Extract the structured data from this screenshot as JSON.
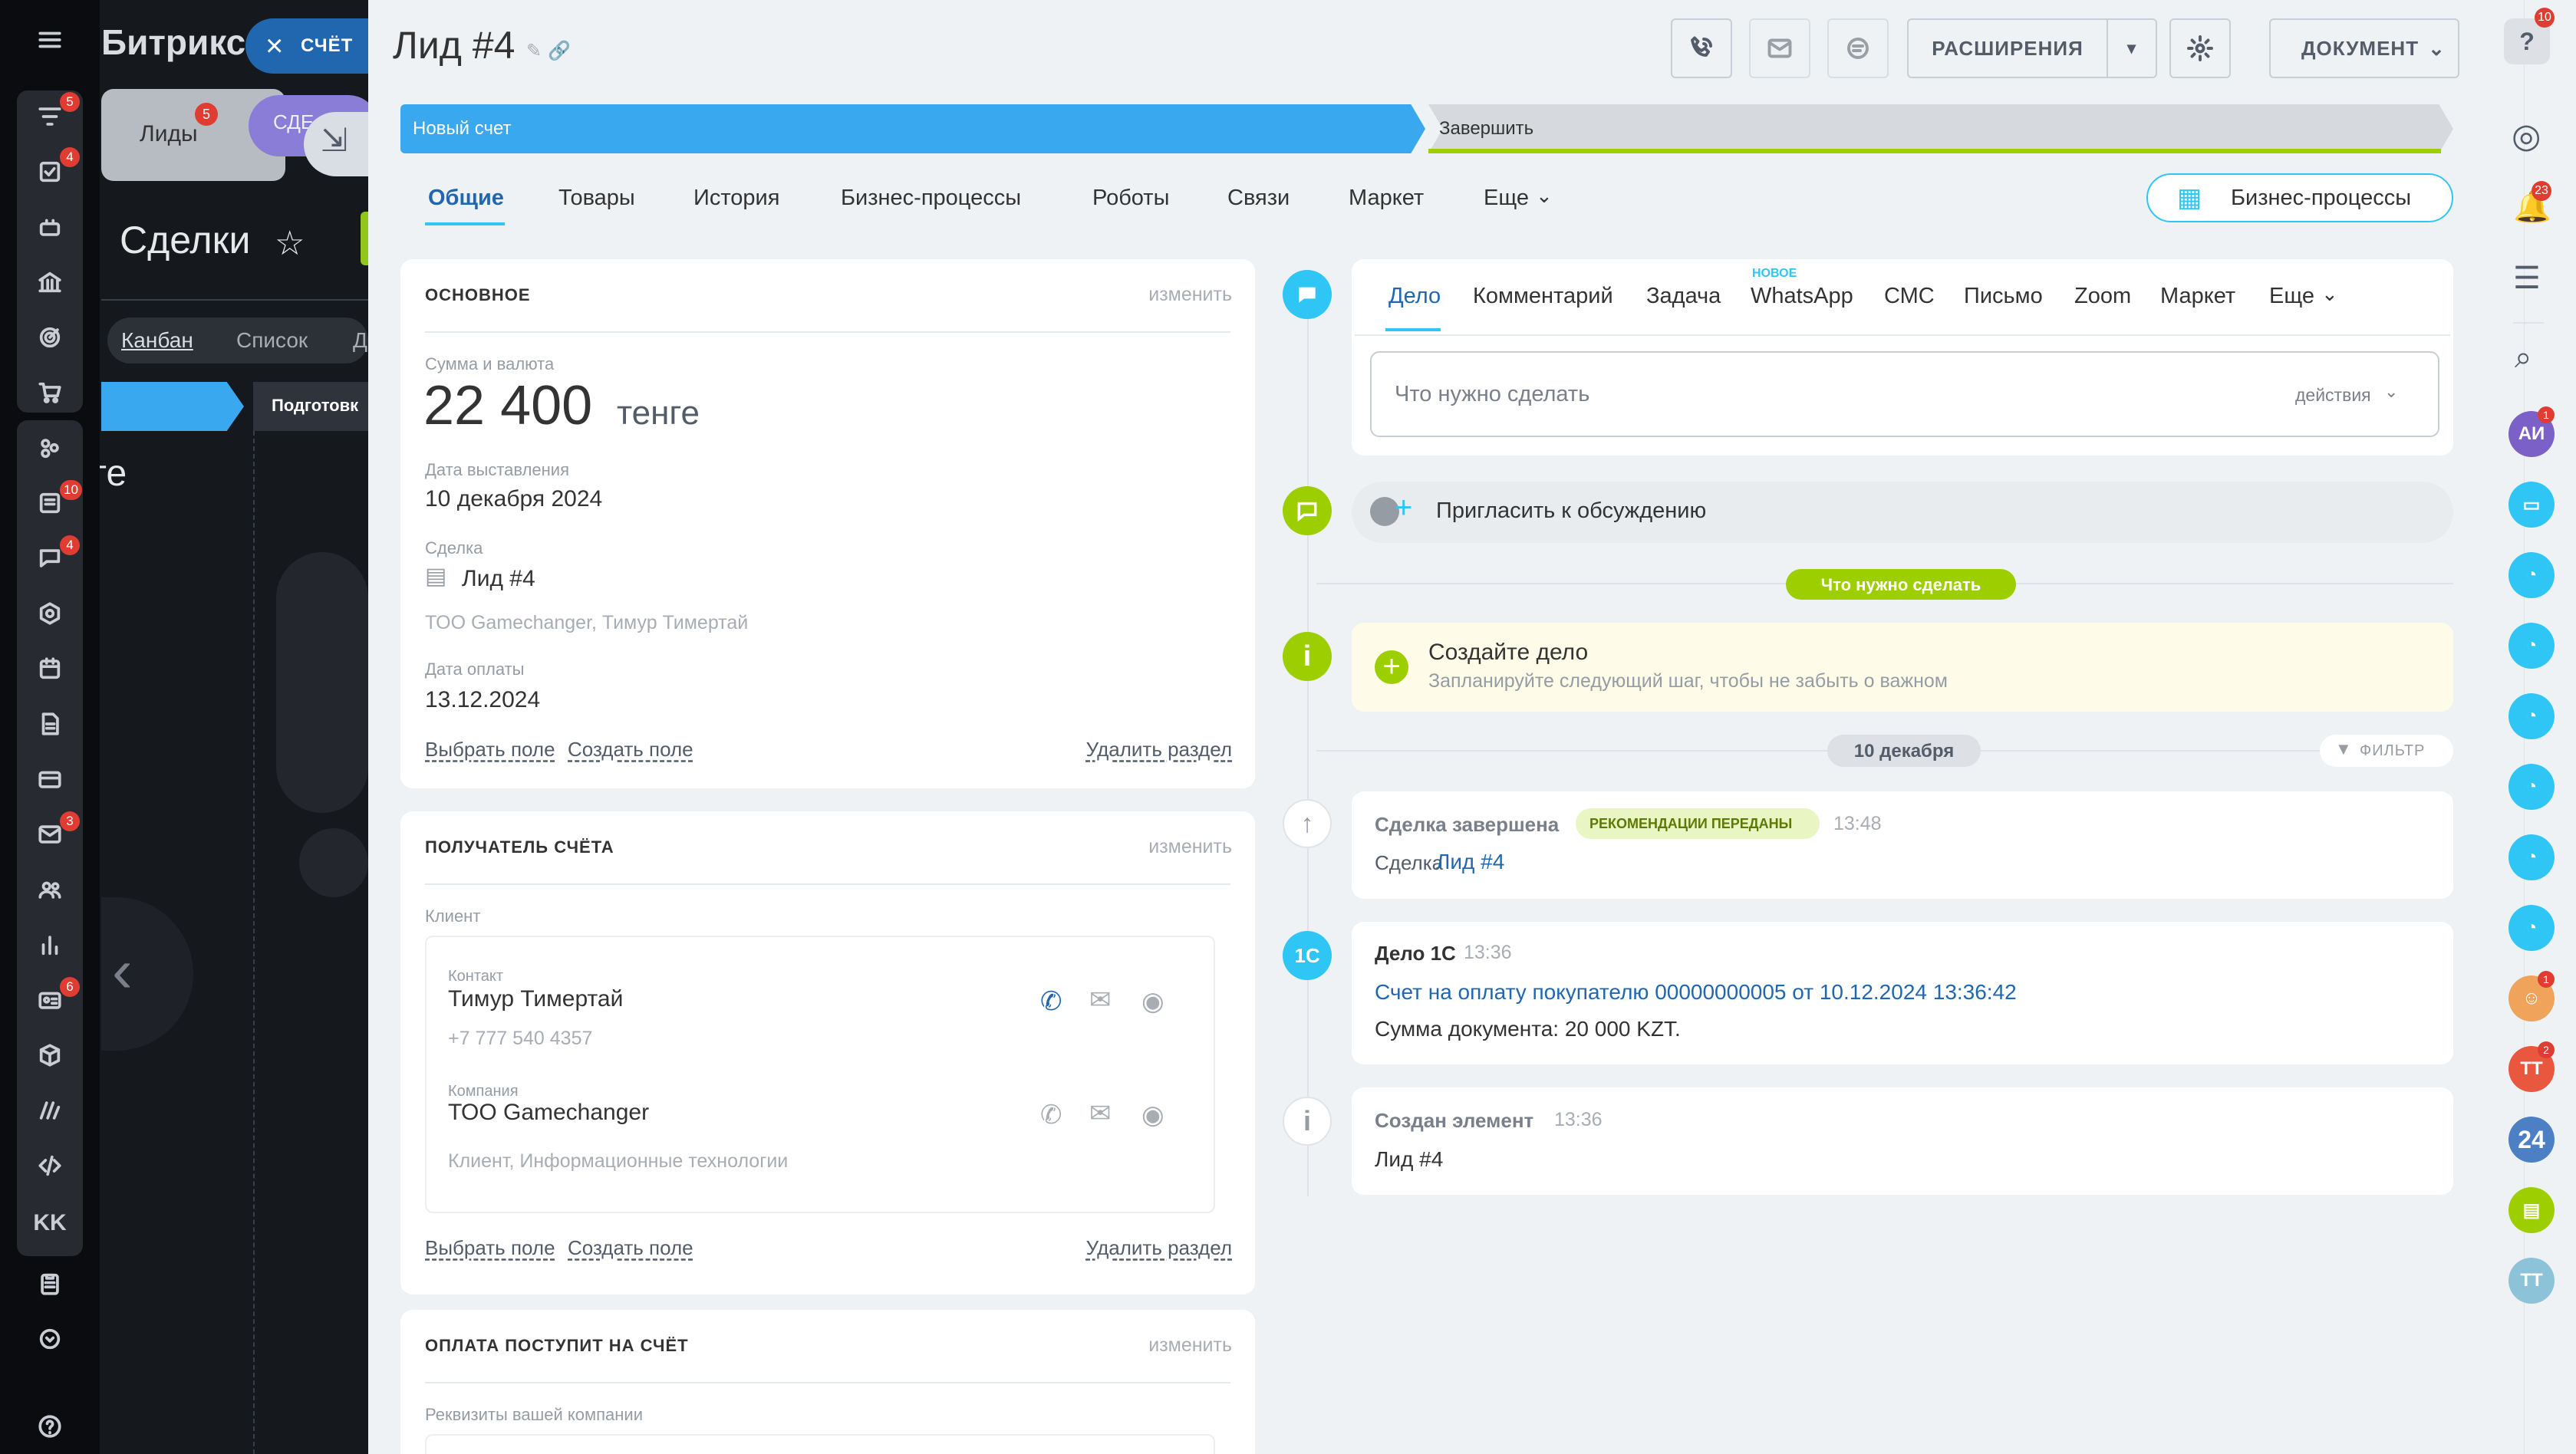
{
  "app": {
    "name": "Битрикс",
    "close_chip": "СЧЁТ"
  },
  "left_nav": {
    "badges": {
      "filter": "5",
      "tasks": "4",
      "feed": "10",
      "chat": "4",
      "mail": "3",
      "crm": "6"
    },
    "kk": "KK"
  },
  "background": {
    "pill_leads": "Лиды",
    "pill_leads_badge": "5",
    "pill_deals": "СДЕ",
    "title": "Сделки",
    "view_kanban": "Канбан",
    "view_list": "Список",
    "view_more": "Д",
    "stage": "Подготовк",
    "cut_text": "ге"
  },
  "header": {
    "title": "Лид #4",
    "extensions": "РАСШИРЕНИЯ",
    "document": "ДОКУМЕНТ"
  },
  "stages": {
    "current": "Новый счет",
    "final": "Завершить"
  },
  "tabs": [
    "Общие",
    "Товары",
    "История",
    "Бизнес-процессы",
    "Роботы",
    "Связи",
    "Маркет",
    "Еще"
  ],
  "bp_button": "Бизнес-процессы",
  "main_section": {
    "title": "ОСНОВНОЕ",
    "edit": "изменить",
    "amount_label": "Сумма и валюта",
    "amount": "22 400",
    "currency": "тенге",
    "issue_date_label": "Дата выставления",
    "issue_date": "10 декабря 2024",
    "deal_label": "Сделка",
    "deal_value": "Лид #4",
    "deal_sub": "ТОО Gamechanger, Тимур Тимертай",
    "pay_date_label": "Дата оплаты",
    "pay_date": "13.12.2024",
    "choose_field": "Выбрать поле",
    "create_field": "Создать поле",
    "delete_section": "Удалить раздел"
  },
  "recipient_section": {
    "title": "ПОЛУЧАТЕЛЬ СЧЁТА",
    "edit": "изменить",
    "client_label": "Клиент",
    "contact_label": "Контакт",
    "contact_name": "Тимур Тимертай",
    "contact_phone": "+7 777 540 4357",
    "company_label": "Компания",
    "company_name": "ТОО Gamechanger",
    "company_sub": "Клиент, Информационные технологии",
    "choose_field": "Выбрать поле",
    "create_field": "Создать поле",
    "delete_section": "Удалить раздел"
  },
  "payment_section": {
    "title": "ОПЛАТА ПОСТУПИТ НА СЧЁТ",
    "edit": "изменить",
    "company_details_label": "Реквизиты вашей компании"
  },
  "timeline": {
    "tabs": [
      "Дело",
      "Комментарий",
      "Задача",
      "WhatsApp",
      "СМС",
      "Письмо",
      "Zoom",
      "Маркет",
      "Еще"
    ],
    "new_badge": "НОВОЕ",
    "todo_placeholder": "Что нужно сделать",
    "actions": "действия",
    "invite": "Пригласить к обсуждению",
    "todo_pill": "Что нужно сделать",
    "create_title": "Создайте дело",
    "create_sub": "Запланируйте следующий шаг, чтобы не забыть о важном",
    "date_pill": "10 декабря",
    "filter": "ФИЛЬТР",
    "items": [
      {
        "title": "Сделка завершена",
        "tag": "РЕКОМЕНДАЦИИ ПЕРЕДАНЫ",
        "time": "13:48",
        "line1_prefix": "Сделка",
        "line1_link": "Лид #4"
      },
      {
        "title": "Дело 1С",
        "time": "13:36",
        "link": "Счет на оплату покупателю 00000000005 от 10.12.2024 13:36:42",
        "line2": "Сумма документа: 20 000 KZT.",
        "icon_text": "1С"
      },
      {
        "title": "Создан элемент",
        "time": "13:36",
        "line1": "Лид #4"
      }
    ]
  },
  "right_bar": {
    "help_badge": "10",
    "bell_badge": "23",
    "avatars": [
      {
        "initials": "АИ",
        "color": "#7b61c7",
        "badge": "1"
      },
      {
        "initials": "ТТ",
        "color": "#e9573f",
        "badge": "2"
      },
      {
        "initials": "24",
        "color": "#4c7fc4"
      },
      {
        "initials": "ТТ",
        "color": "#8cc3d8"
      }
    ]
  },
  "colors": {
    "accent": "#2fc6f6",
    "stage_active": "#39a8ef",
    "green": "#9dcf00",
    "link": "#2067b0"
  }
}
